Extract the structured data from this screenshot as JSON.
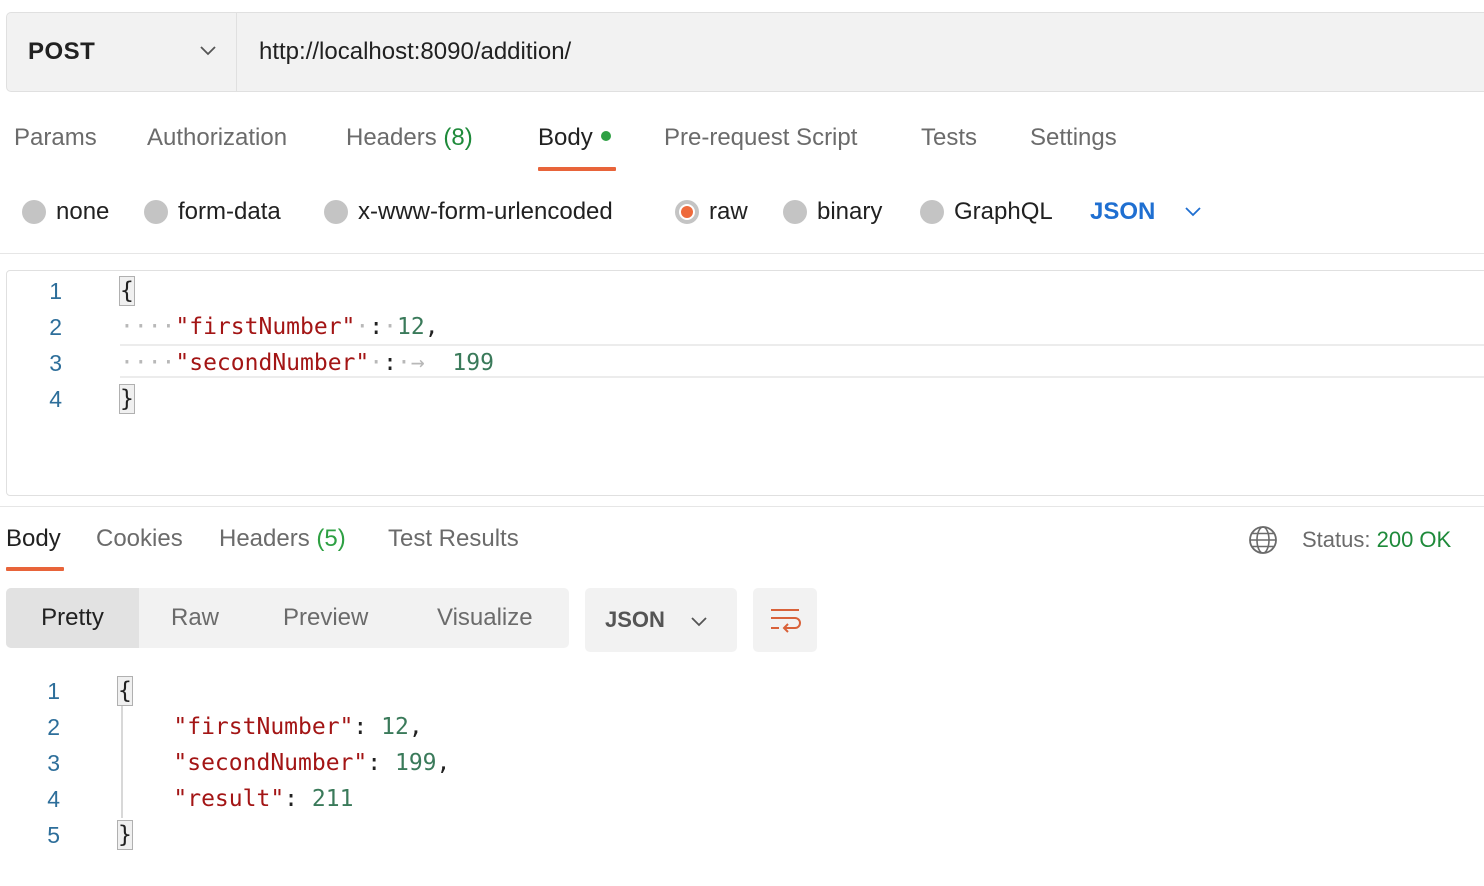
{
  "request": {
    "method": "POST",
    "url": "http://localhost:8090/addition/"
  },
  "request_tabs": {
    "params": "Params",
    "authorization": "Authorization",
    "headers_label": "Headers",
    "headers_count": "(8)",
    "body": "Body",
    "prerequest": "Pre-request Script",
    "tests": "Tests",
    "settings": "Settings"
  },
  "body_types": {
    "none": "none",
    "form_data": "form-data",
    "urlencoded": "x-www-form-urlencoded",
    "raw": "raw",
    "binary": "binary",
    "graphql": "GraphQL",
    "selected": "raw",
    "format": "JSON"
  },
  "request_body": {
    "line_numbers": [
      "1",
      "2",
      "3",
      "4"
    ],
    "open_brace": "{",
    "key1": "\"firstNumber\"",
    "value1": "12",
    "key2": "\"secondNumber\"",
    "value2": "199",
    "close_brace": "}"
  },
  "response_tabs": {
    "body": "Body",
    "cookies": "Cookies",
    "headers_label": "Headers",
    "headers_count": "(5)",
    "test_results": "Test Results"
  },
  "status": {
    "label": "Status:",
    "value": "200 OK"
  },
  "view_modes": {
    "pretty": "Pretty",
    "raw": "Raw",
    "preview": "Preview",
    "visualize": "Visualize",
    "format": "JSON"
  },
  "response_body": {
    "line_numbers": [
      "1",
      "2",
      "3",
      "4",
      "5"
    ],
    "open_brace": "{",
    "key1": "\"firstNumber\"",
    "value1": "12",
    "key2": "\"secondNumber\"",
    "value2": "199",
    "key3": "\"result\"",
    "value3": "211",
    "close_brace": "}"
  },
  "colors": {
    "accent": "#e8643a",
    "json_key": "#a31515",
    "json_number": "#3a7a5a",
    "status_ok": "#1e8a3a",
    "link_blue": "#1f6fd1"
  },
  "icons": [
    "chevron-down-icon",
    "globe-icon",
    "wrap-lines-icon"
  ]
}
